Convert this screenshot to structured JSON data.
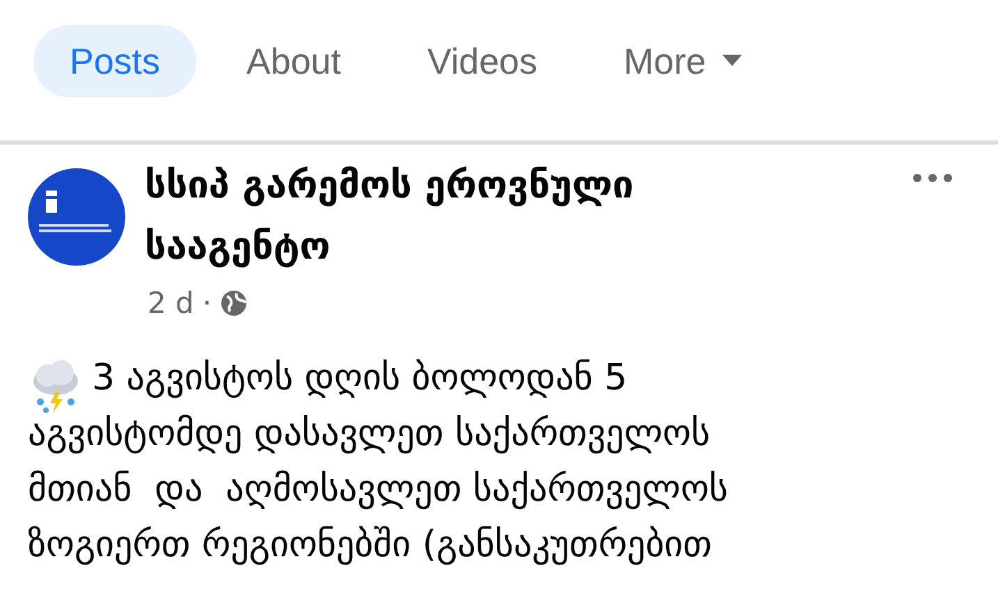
{
  "tabs": [
    {
      "label": "Posts",
      "selected": true,
      "kind": "plain"
    },
    {
      "label": "About",
      "selected": false,
      "kind": "plain"
    },
    {
      "label": "Videos",
      "selected": false,
      "kind": "plain"
    },
    {
      "label": "More",
      "selected": false,
      "kind": "menu"
    }
  ],
  "post": {
    "author": "სსიპ გარემოს ეროვნული\nსააგენტო",
    "time": "2 d",
    "separator": "·",
    "text_lines": [
      "3 აგვისტოს დღის ბოლოდან 5",
      "აგვისტომდე დასავლეთ საქართველოს",
      "მთიან  და  აღმოსავლეთ საქართველოს",
      "ზოგიერთ რეგიონებში (განსაკუთრებით"
    ]
  }
}
